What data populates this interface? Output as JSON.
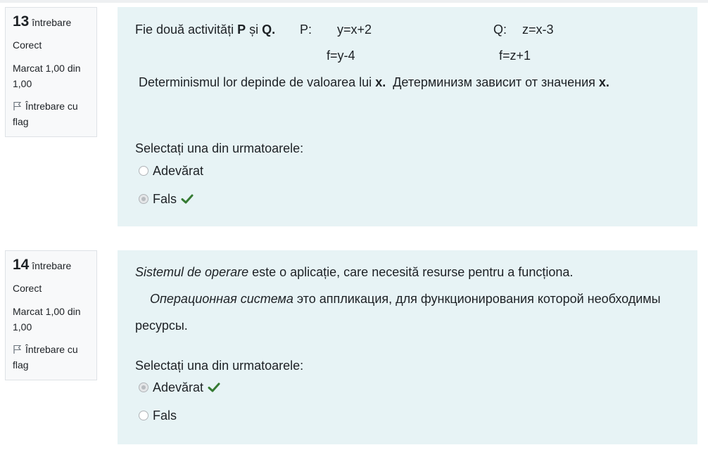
{
  "questions": [
    {
      "number": "13",
      "number_word": "întrebare",
      "state": "Corect",
      "grade": "Marcat 1,00 din 1,00",
      "flag_label": "Întrebare cu flag",
      "text": {
        "lead": "Fie două activități ",
        "p": "P",
        "and": " și ",
        "q": "Q.",
        "p_label": "P:",
        "p_eq1": "y=x+2",
        "p_eq2": "f=y-4",
        "q_label": "Q:",
        "q_eq1": "z=x-3",
        "q_eq2": "f=z+1",
        "det_ro": "Determinismul lor depinde de valoarea lui ",
        "det_ro_var": "x.",
        "det_ru": "Детерминизм зависит от значения ",
        "det_ru_var": "x."
      },
      "prompt": "Selectați una din urmatoarele:",
      "options": [
        {
          "label": "Adevărat",
          "selected": false,
          "correct": false
        },
        {
          "label": "Fals",
          "selected": true,
          "correct": true
        }
      ]
    },
    {
      "number": "14",
      "number_word": "întrebare",
      "state": "Corect",
      "grade": "Marcat 1,00 din 1,00",
      "flag_label": "Întrebare cu flag",
      "text": {
        "ro_italic": "Sistemul de operare",
        "ro_rest": " este o aplicație, care necesită resurse pentru a funcționa.",
        "ru_italic": "Операционная система",
        "ru_rest": " это аппликация, для функционирования которой необходимы",
        "ru_line2": "ресурсы."
      },
      "prompt": "Selectați una din urmatoarele:",
      "options": [
        {
          "label": "Adevărat",
          "selected": true,
          "correct": true
        },
        {
          "label": "Fals",
          "selected": false,
          "correct": false
        }
      ]
    }
  ],
  "colors": {
    "content_bg": "#e7f3f5",
    "info_bg": "#f8f9fa",
    "correct_check": "#357a32"
  },
  "icons": {
    "flag": "flag-outline-icon",
    "correct": "checkmark-icon"
  }
}
